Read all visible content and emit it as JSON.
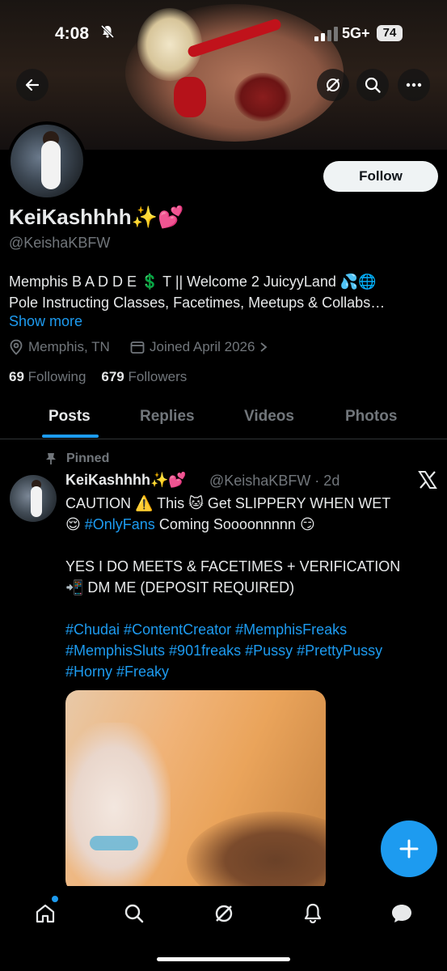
{
  "status_bar": {
    "time": "4:08",
    "network": "5G+",
    "battery": "74"
  },
  "profile": {
    "follow_label": "Follow",
    "display_name": "KeiKashhhh✨💕",
    "handle": "@KeishaKBFW",
    "bio_line1": "Memphis B A D D E 💲 T || Welcome 2 JuicyyLand 💦🌐",
    "bio_line2": "Pole Instructing Classes, Facetimes, Meetups & Collabs…",
    "show_more": "Show more",
    "location": "Memphis, TN",
    "joined": "Joined April 2026",
    "following_count": "69",
    "following_label": "Following",
    "followers_count": "679",
    "followers_label": "Followers"
  },
  "tabs": {
    "posts": "Posts",
    "replies": "Replies",
    "videos": "Videos",
    "photos": "Photos",
    "active": "Posts"
  },
  "post": {
    "pinned_label": "Pinned",
    "author_name": "KeiKashhhh✨💕",
    "author_handle_time": "@KeishaKBFW · 2d",
    "line1_a": "CAUTION ⚠️ This 🐱 Get SLIPPERY WHEN WET",
    "line2_a": "😌 ",
    "line2_tag": "#OnlyFans",
    "line2_b": " Coming Soooonnnnn 😏",
    "line3": "YES I DO MEETS & FACETIMES + VERIFICATION",
    "line4": "📲 DM ME (DEPOSIT REQUIRED)",
    "tags_line1": "#Chudai #ContentCreator #MemphisFreaks",
    "tags_line2": "#MemphisSluts #901freaks #Pussy #PrettyPussy",
    "tags_line3": "#Horny #Freaky"
  },
  "icons": {
    "back": "back-arrow-icon",
    "grok": "grok-icon",
    "search": "search-icon",
    "more": "more-icon",
    "location": "location-pin-icon",
    "calendar": "calendar-icon",
    "pin": "pin-icon",
    "x": "x-logo-icon",
    "compose": "plus-icon",
    "home": "home-icon",
    "notifications": "bell-icon",
    "messages": "chat-bubble-icon"
  },
  "colors": {
    "accent": "#1d9bf0",
    "background": "#000000",
    "text": "#e7e9ea",
    "muted": "#71767b"
  }
}
